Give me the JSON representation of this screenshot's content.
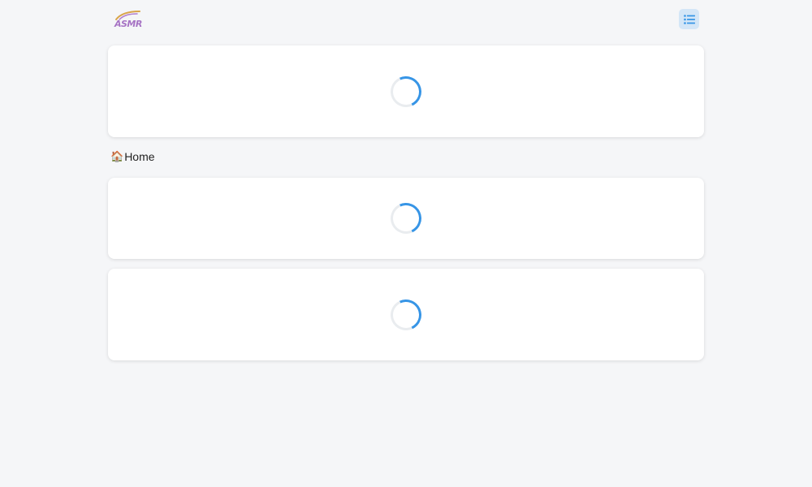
{
  "header": {
    "logo_text": "ASMR",
    "menu_icon": "list-icon"
  },
  "breadcrumb": {
    "home_icon": "🏠",
    "home_label": "Home"
  },
  "colors": {
    "background": "#f5f6f8",
    "accent": "#3795e6",
    "menu_button_bg": "#d4e6f7",
    "logo_color": "#a673c4"
  }
}
